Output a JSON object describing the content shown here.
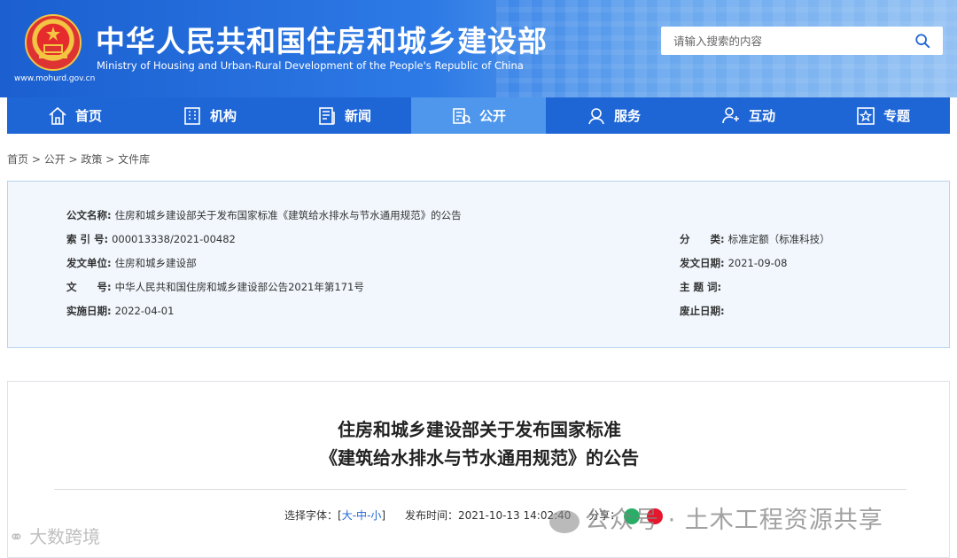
{
  "header": {
    "title_cn": "中华人民共和国住房和城乡建设部",
    "title_en": "Ministry of Housing and Urban-Rural Development of the People's Republic of China",
    "site_url": "www.mohurd.gov.cn",
    "emblem_icon": "national-emblem-icon"
  },
  "search": {
    "placeholder": "请输入搜索的内容",
    "icon": "search-icon"
  },
  "nav": {
    "items": [
      {
        "label": "首页",
        "icon": "home-icon"
      },
      {
        "label": "机构",
        "icon": "building-icon"
      },
      {
        "label": "新闻",
        "icon": "newspaper-icon"
      },
      {
        "label": "公开",
        "icon": "document-open-icon",
        "active": true
      },
      {
        "label": "服务",
        "icon": "service-icon"
      },
      {
        "label": "互动",
        "icon": "interaction-icon"
      },
      {
        "label": "专题",
        "icon": "star-icon"
      }
    ]
  },
  "breadcrumb": {
    "items": [
      "首页",
      "公开",
      "政策",
      "文件库"
    ],
    "separator": " > "
  },
  "info": {
    "doc_name_label": "公文名称:",
    "doc_name_value": "住房和城乡建设部关于发布国家标准《建筑给水排水与节水通用规范》的公告",
    "index_label": "索 引 号:",
    "index_value": "000013338/2021-00482",
    "category_label": "分　　类:",
    "category_value": "标准定额（标准科技）",
    "issuer_label": "发文单位:",
    "issuer_value": "住房和城乡建设部",
    "issue_date_label": "发文日期:",
    "issue_date_value": "2021-09-08",
    "doc_no_label": "文　　号:",
    "doc_no_value": "中华人民共和国住房和城乡建设部公告2021年第171号",
    "subject_label": "主 题 词:",
    "subject_value": "",
    "effective_label": "实施日期:",
    "effective_value": "2022-04-01",
    "repeal_label": "废止日期:",
    "repeal_value": ""
  },
  "article": {
    "title_line1": "住房和城乡建设部关于发布国家标准",
    "title_line2": "《建筑给水排水与节水通用规范》的公告",
    "font_label": "选择字体：[",
    "font_large": "大",
    "font_medium": "中",
    "font_small": "小",
    "font_sep": "-",
    "font_end": "]",
    "publish_label": "发布时间：",
    "publish_time": "2021-10-13 14:02:40",
    "share_label": "分享："
  },
  "watermarks": {
    "left": "大数跨境",
    "right": "公众号 · 土木工程资源共享"
  },
  "colors": {
    "nav_bg": "#1e66d6",
    "nav_active": "#4e97ec",
    "info_bg": "#f1f7fd",
    "info_border": "#b9d4ef"
  }
}
